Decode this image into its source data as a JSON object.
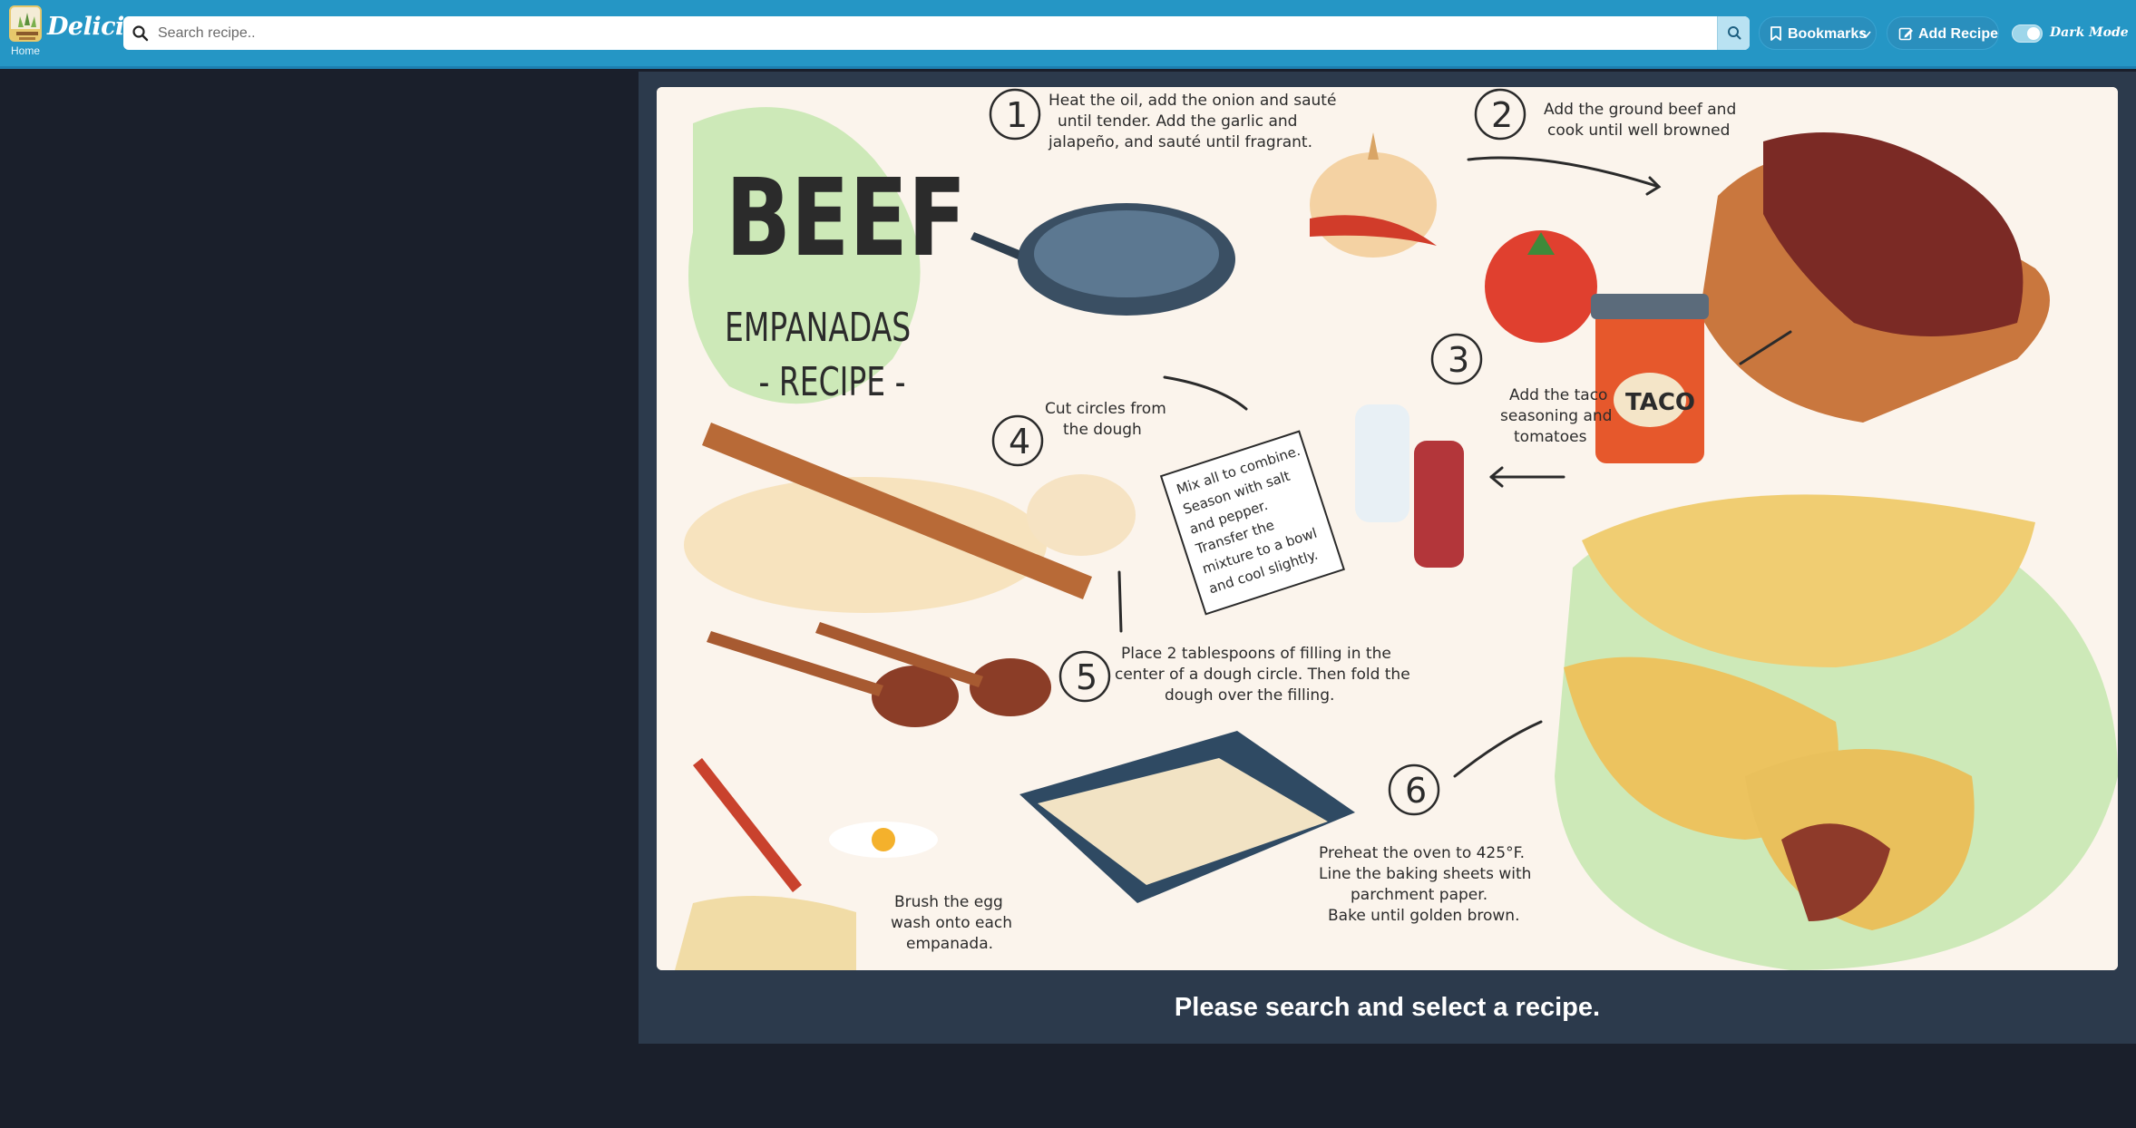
{
  "app": {
    "brand": "Delicious",
    "home_label": "Home"
  },
  "search": {
    "placeholder": "Search recipe..",
    "value": ""
  },
  "nav": {
    "bookmarks_label": "Bookmarks",
    "add_recipe_label": "Add Recipe",
    "dark_mode_label": "Dark Mode",
    "dark_mode_on": true
  },
  "main": {
    "message": "Please search and select a recipe."
  },
  "poster": {
    "title_1": "BEEF",
    "title_2": "EMPANADAS",
    "title_3": "- RECIPE -",
    "taco_label": "TACO",
    "steps": [
      {
        "number": "1",
        "lines": [
          "Heat the oil, add the onion and sauté",
          "until tender. Add the garlic and",
          "jalapeño, and sauté until fragrant."
        ]
      },
      {
        "number": "2",
        "lines": [
          "Add the ground beef and",
          "cook until well browned"
        ]
      },
      {
        "number": "3",
        "lines": [
          "Add the taco",
          "seasoning and",
          "tomatoes"
        ]
      },
      {
        "number": "4",
        "lines": [
          "Cut circles from",
          "the dough"
        ]
      },
      {
        "number": "5",
        "lines": [
          "Place 2 tablespoons of filling in the",
          "center of a dough circle. Then fold the",
          "dough over the filling."
        ]
      },
      {
        "number": "6",
        "lines": [
          "Preheat the oven to 425°F.",
          "Line the baking sheets with",
          "parchment paper.",
          "Bake until golden brown."
        ]
      }
    ],
    "mix_note": [
      "Mix all to combine.",
      "Season with salt",
      "and pepper.",
      "Transfer the",
      "mixture to a bowl",
      "and cool slightly."
    ],
    "egg_note": [
      "Brush the egg",
      "wash onto each",
      "empanada."
    ]
  },
  "colors": {
    "topbar": "#2596c5",
    "page_bg": "#1a1f2b",
    "panel_bg": "#2c3a4c",
    "poster_bg": "#fbf4ec",
    "highlight_green": "#cde9b8"
  }
}
